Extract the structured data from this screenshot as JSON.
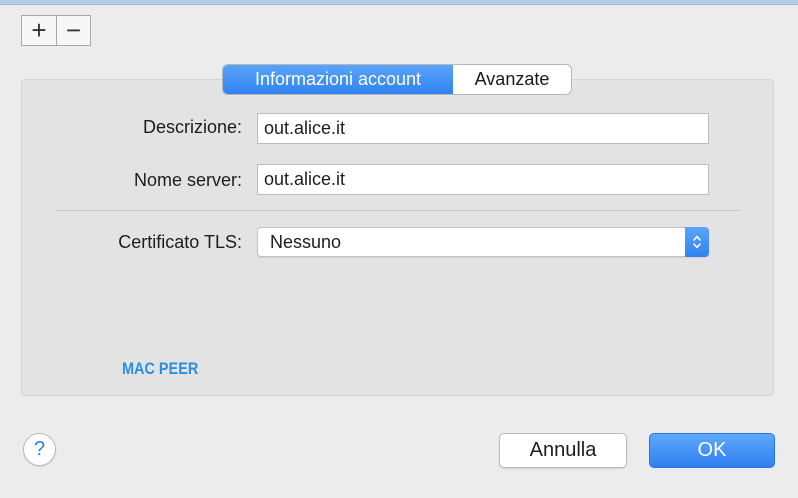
{
  "toolbar": {
    "add_label": "+",
    "remove_label": "−"
  },
  "tabs": [
    {
      "label": "Informazioni account",
      "active": true
    },
    {
      "label": "Avanzate",
      "active": false
    }
  ],
  "form": {
    "description_label": "Descrizione:",
    "description_value": "out.alice.it",
    "server_label": "Nome server:",
    "server_value": "out.alice.it",
    "tls_label": "Certificato TLS:",
    "tls_value": "Nessuno"
  },
  "watermark": "MAC PEER",
  "footer": {
    "help_label": "?",
    "cancel_label": "Annulla",
    "ok_label": "OK"
  },
  "colors": {
    "accent": "#2f82f0",
    "watermark": "#2a8fe0"
  },
  "icons": [
    "plus-icon",
    "minus-icon",
    "updown-chevron-icon",
    "help-icon"
  ]
}
